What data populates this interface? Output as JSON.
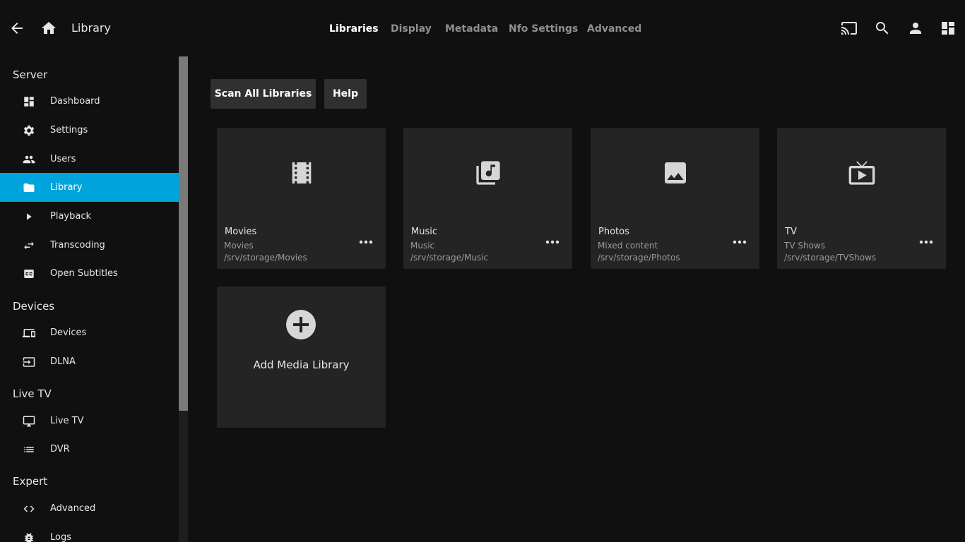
{
  "header": {
    "title": "Library",
    "tabs": [
      {
        "label": "Libraries",
        "active": true
      },
      {
        "label": "Display",
        "active": false
      },
      {
        "label": "Metadata",
        "active": false
      },
      {
        "label": "Nfo Settings",
        "active": false
      },
      {
        "label": "Advanced",
        "active": false
      }
    ],
    "icons": [
      "back-arrow-icon",
      "home-icon",
      "cast-icon",
      "search-icon",
      "user-icon",
      "dashboard-icon"
    ]
  },
  "sidebar": {
    "sections": [
      {
        "title": "Server",
        "items": [
          {
            "label": "Dashboard",
            "icon": "dashboard-icon"
          },
          {
            "label": "Settings",
            "icon": "gear-icon"
          },
          {
            "label": "Users",
            "icon": "people-icon"
          },
          {
            "label": "Library",
            "icon": "folder-icon",
            "active": true
          },
          {
            "label": "Playback",
            "icon": "play-icon"
          },
          {
            "label": "Transcoding",
            "icon": "swap-arrows-icon"
          },
          {
            "label": "Open Subtitles",
            "icon": "closed-caption-icon"
          }
        ]
      },
      {
        "title": "Devices",
        "items": [
          {
            "label": "Devices",
            "icon": "devices-icon"
          },
          {
            "label": "DLNA",
            "icon": "input-icon"
          }
        ]
      },
      {
        "title": "Live TV",
        "items": [
          {
            "label": "Live TV",
            "icon": "monitor-icon"
          },
          {
            "label": "DVR",
            "icon": "list-icon"
          }
        ]
      },
      {
        "title": "Expert",
        "items": [
          {
            "label": "Advanced",
            "icon": "code-icon"
          },
          {
            "label": "Logs",
            "icon": "bug-icon"
          }
        ]
      }
    ]
  },
  "main": {
    "buttons": {
      "scan_all": "Scan All Libraries",
      "help": "Help"
    },
    "libraries": [
      {
        "name": "Movies",
        "type": "Movies",
        "path": "/srv/storage/Movies",
        "icon": "film-icon"
      },
      {
        "name": "Music",
        "type": "Music",
        "path": "/srv/storage/Music",
        "icon": "music-library-icon"
      },
      {
        "name": "Photos",
        "type": "Mixed content",
        "path": "/srv/storage/Photos",
        "icon": "photo-icon"
      },
      {
        "name": "TV",
        "type": "TV Shows",
        "path": "/srv/storage/TVShows",
        "icon": "tv-icon"
      }
    ],
    "add_library": {
      "label": "Add Media Library",
      "icon": "add-circle-icon"
    }
  },
  "colors": {
    "background": "#101010",
    "card": "#242424",
    "accent": "#00a4dc",
    "button": "#303030"
  }
}
